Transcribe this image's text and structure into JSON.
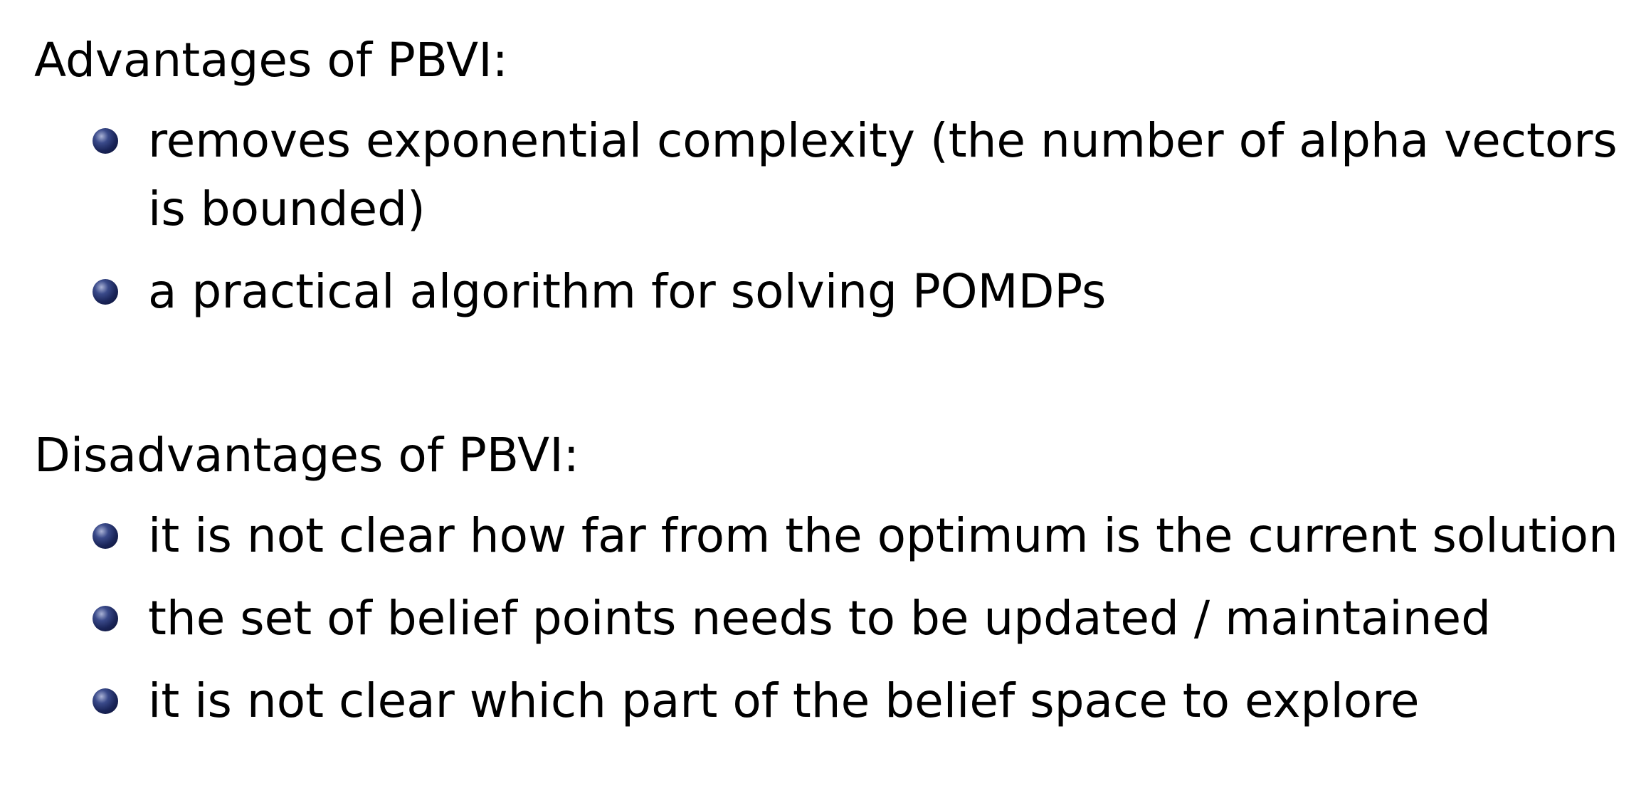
{
  "advantages": {
    "heading": "Advantages of PBVI:",
    "items": [
      "removes exponential complexity (the number of alpha vectors is bounded)",
      "a practical algorithm for solving POMDPs"
    ]
  },
  "disadvantages": {
    "heading": "Disadvantages of PBVI:",
    "items": [
      "it is not clear how far from the optimum is the current solution",
      "the set of belief points needs to be updated / maintained",
      "it is not clear which part of the belief space to explore"
    ]
  },
  "colors": {
    "bullet": "#1a2559",
    "text": "#000000",
    "background": "#ffffff"
  },
  "icons": {
    "bullet": "ball-bullet-icon"
  }
}
